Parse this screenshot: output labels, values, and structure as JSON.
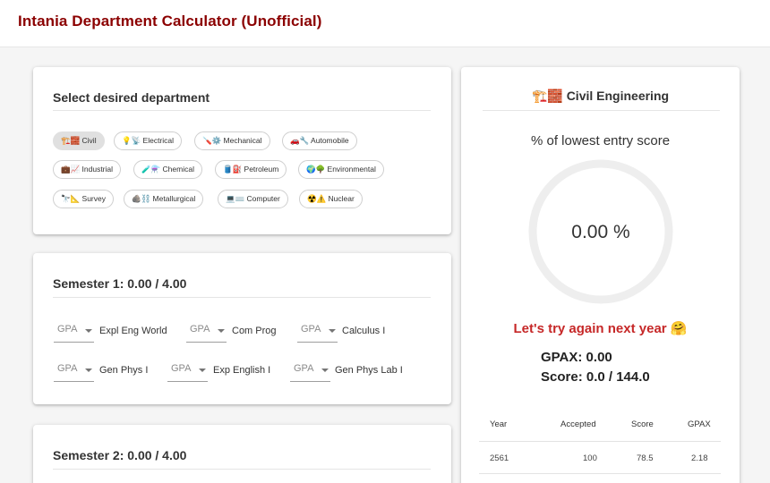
{
  "app": {
    "title": "Intania Department Calculator (Unofficial)"
  },
  "department_card": {
    "title": "Select desired department",
    "chips": [
      {
        "label": "🏗️🧱 Civil",
        "selected": true
      },
      {
        "label": "💡📡 Electrical"
      },
      {
        "label": "🪛⚙️ Mechanical"
      },
      {
        "label": "🚗🔧 Automobile"
      },
      {
        "label": "💼📈 Industrial"
      },
      {
        "label": "🧪⚗️ Chemical"
      },
      {
        "label": "🛢️⛽ Petroleum"
      },
      {
        "label": "🌍🌳 Environmental"
      },
      {
        "label": "🔭📐 Survey"
      },
      {
        "label": "🪨⛓️ Metallurgical"
      },
      {
        "label": "💻⌨️ Computer"
      },
      {
        "label": "☢️⚠️ Nuclear"
      }
    ]
  },
  "semesters": [
    {
      "title": "Semester 1: 0.00 / 4.00",
      "gpa_placeholder": "GPA",
      "courses": [
        "Expl Eng World",
        "Com Prog",
        "Calculus I",
        "Gen Phys I",
        "Exp English I",
        "Gen Phys Lab I"
      ]
    },
    {
      "title": "Semester 2: 0.00 / 4.00"
    }
  ],
  "result_panel": {
    "department": "🏗️🧱 Civil Engineering",
    "percent_label": "% of lowest entry score",
    "percent_value": "0.00 %",
    "percent_fraction": 0,
    "message": "Let's try again next year 🤗",
    "gpax": "GPAX: 0.00",
    "score": "Score: 0.0 / 144.0",
    "table": {
      "headers": [
        "Year",
        "Accepted",
        "Score",
        "GPAX"
      ],
      "rows": [
        [
          "2561",
          "100",
          "78.5",
          "2.18"
        ]
      ]
    }
  },
  "colors": {
    "title": "#8b0000",
    "message": "#c62828",
    "ring_track": "#eeeeee"
  }
}
